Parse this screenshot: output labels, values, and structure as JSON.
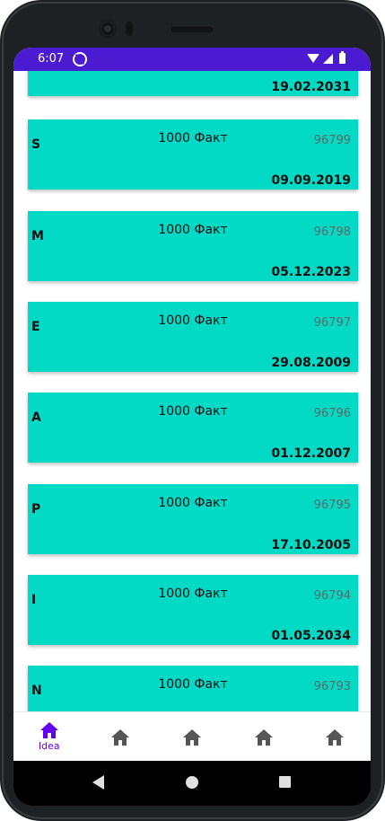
{
  "status_bar": {
    "time": "6:07"
  },
  "partial_card": {
    "date": "19.02.2031"
  },
  "cards": [
    {
      "letter": "S",
      "title": "1000 Факт",
      "id": "96799",
      "date": "09.09.2019"
    },
    {
      "letter": "M",
      "title": "1000 Факт",
      "id": "96798",
      "date": "05.12.2023"
    },
    {
      "letter": "E",
      "title": "1000 Факт",
      "id": "96797",
      "date": "29.08.2009"
    },
    {
      "letter": "A",
      "title": "1000 Факт",
      "id": "96796",
      "date": "01.12.2007"
    },
    {
      "letter": "P",
      "title": "1000 Факт",
      "id": "96795",
      "date": "17.10.2005"
    },
    {
      "letter": "I",
      "title": "1000 Факт",
      "id": "96794",
      "date": "01.05.2034"
    },
    {
      "letter": "N",
      "title": "1000 Факт",
      "id": "96793",
      "date": ""
    }
  ],
  "bottom_nav": {
    "items": [
      {
        "label": "Idea",
        "icon": "home-icon",
        "active": true
      },
      {
        "label": "",
        "icon": "home-icon",
        "active": false
      },
      {
        "label": "",
        "icon": "home-icon",
        "active": false
      },
      {
        "label": "",
        "icon": "home-icon",
        "active": false
      },
      {
        "label": "",
        "icon": "home-icon",
        "active": false
      }
    ]
  },
  "colors": {
    "status_bar": "#4b1bd2",
    "card": "#03dac5",
    "accent": "#6200ee"
  }
}
